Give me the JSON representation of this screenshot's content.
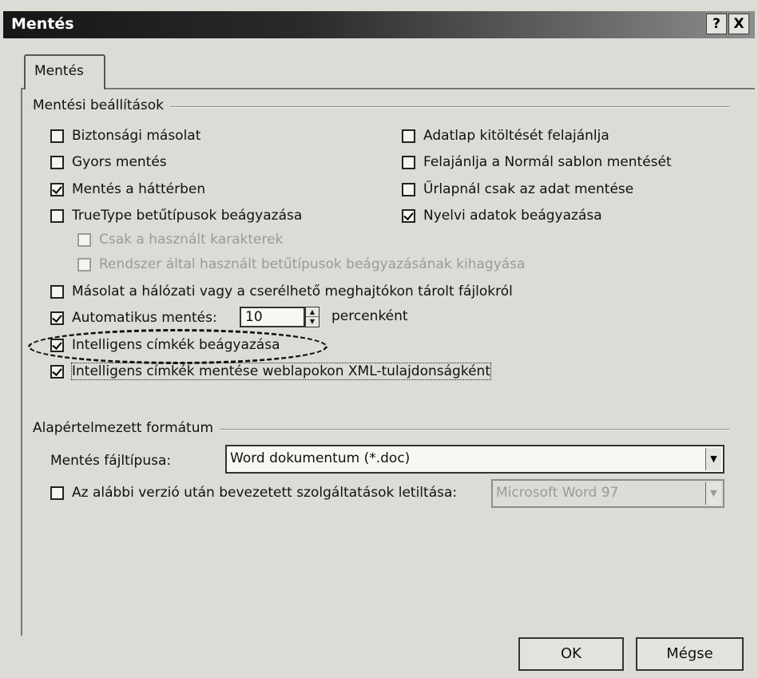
{
  "window": {
    "title": "Mentés",
    "help_button": "?",
    "close_button": "X"
  },
  "tab": {
    "label": "Mentés"
  },
  "save_settings": {
    "group_title": "Mentési beállítások",
    "left_options": [
      {
        "label": "Biztonsági másolat",
        "checked": false,
        "enabled": true
      },
      {
        "label": "Gyors mentés",
        "checked": false,
        "enabled": true
      },
      {
        "label": "Mentés a háttérben",
        "checked": true,
        "enabled": true
      },
      {
        "label": "TrueType betűtípusok beágyazása",
        "checked": false,
        "enabled": true
      }
    ],
    "right_options": [
      {
        "label": "Adatlap kitöltését felajánlja",
        "checked": false,
        "enabled": true
      },
      {
        "label": "Felajánlja a Normál sablon mentését",
        "checked": false,
        "enabled": true
      },
      {
        "label": "Űrlapnál csak az adat mentése",
        "checked": false,
        "enabled": true
      },
      {
        "label": "Nyelvi adatok beágyazása",
        "checked": true,
        "enabled": true
      }
    ],
    "sub_options": [
      {
        "label": "Csak a használt karakterek",
        "checked": false,
        "enabled": false
      },
      {
        "label": "Rendszer által használt betűtípusok beágyazásának kihagyása",
        "checked": false,
        "enabled": false
      }
    ],
    "network_copy": {
      "label": "Másolat a hálózati vagy a cserélhető meghajtókon tárolt fájlokról",
      "checked": false
    },
    "autosave": {
      "label": "Automatikus mentés:",
      "checked": true,
      "minutes_value": "10",
      "unit_label": "percenként"
    },
    "smart_tags_embed": {
      "label": "Intelligens címkék beágyazása",
      "checked": true
    },
    "smart_tags_xml": {
      "label": "Intelligens címkék mentése weblapokon XML-tulajdonságként",
      "checked": true
    }
  },
  "default_format": {
    "group_title": "Alapértelmezett formátum",
    "save_as_label": "Mentés fájltípusa:",
    "save_as_value": "Word dokumentum (*.doc)",
    "disable_features": {
      "label": "Az alábbi verzió után bevezetett szolgáltatások letiltása:",
      "checked": false,
      "version_value": "Microsoft Word 97"
    }
  },
  "buttons": {
    "ok": "OK",
    "cancel": "Mégse"
  }
}
